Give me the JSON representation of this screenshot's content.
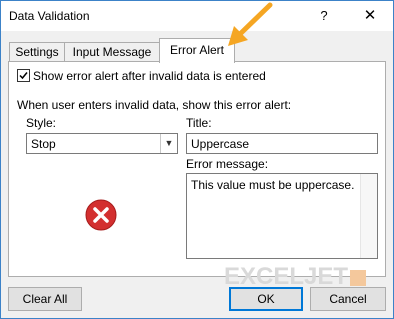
{
  "window": {
    "title": "Data Validation",
    "help_label": "?",
    "close_label": "✕"
  },
  "tabs": [
    {
      "label": "Settings"
    },
    {
      "label": "Input Message"
    },
    {
      "label": "Error Alert"
    }
  ],
  "error_alert": {
    "show_alert_checked": true,
    "show_alert_label": "Show error alert after invalid data is entered",
    "section_label": "When user enters invalid data, show this error alert:",
    "style_label": "Style:",
    "style_value": "Stop",
    "title_label": "Title:",
    "title_value": "Uppercase",
    "message_label": "Error message:",
    "message_value": "This value must be uppercase.",
    "icon": "error-x-icon"
  },
  "buttons": {
    "clear_all": "Clear All",
    "ok": "OK",
    "cancel": "Cancel"
  },
  "watermark": "EXCELJET",
  "colors": {
    "accent": "#0078d7",
    "error_red": "#d32f2f",
    "arrow": "#f5a623"
  }
}
